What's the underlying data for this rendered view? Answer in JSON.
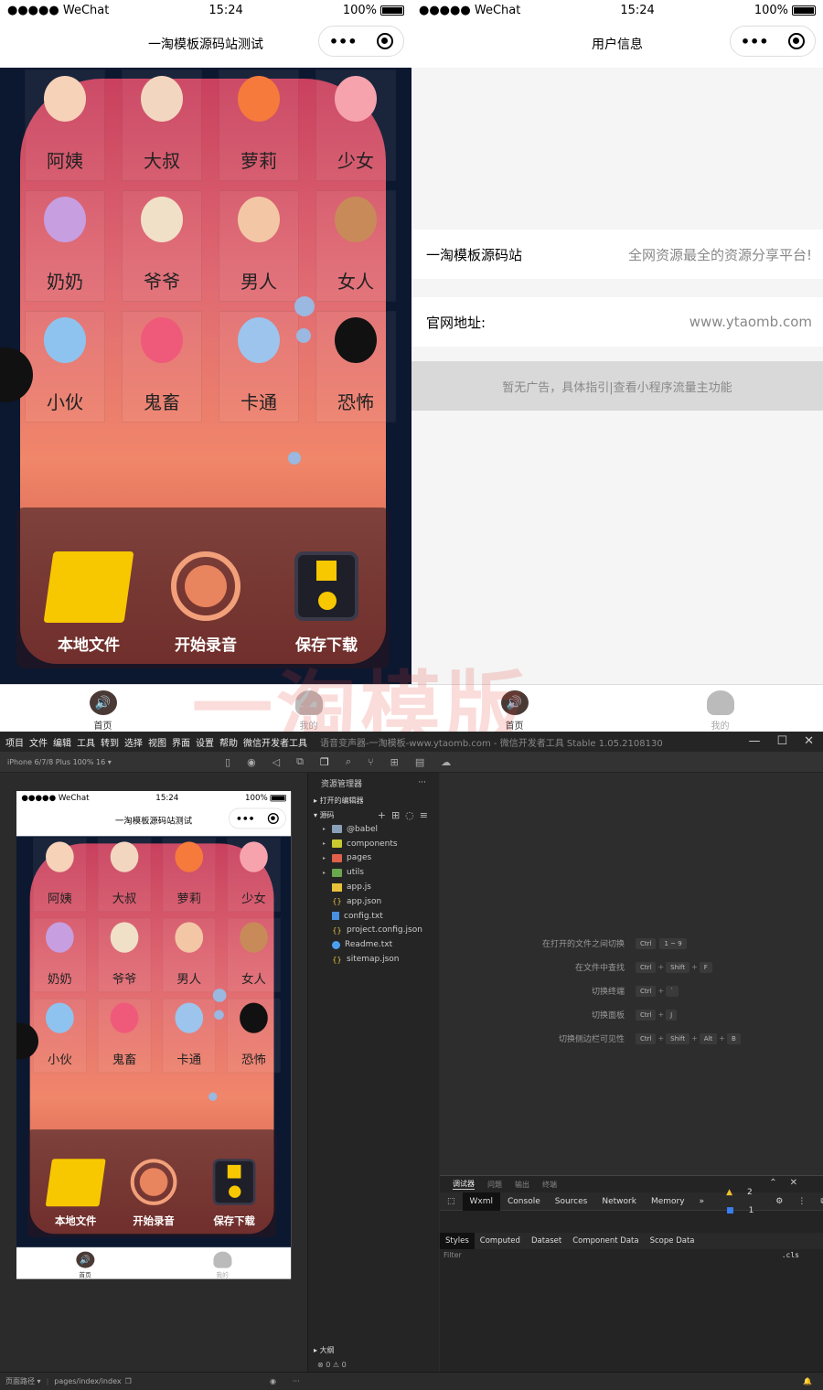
{
  "phone_left": {
    "carrier": "●●●●● WeChat",
    "time": "15:24",
    "battery": "100%",
    "title": "一淘模板源码站测试",
    "grid": [
      {
        "label": "阿姨",
        "color": "#f6d2b8"
      },
      {
        "label": "大叔",
        "color": "#f3d6c0"
      },
      {
        "label": "萝莉",
        "color": "#f57a3c"
      },
      {
        "label": "少女",
        "color": "#f7a3ad"
      },
      {
        "label": "奶奶",
        "color": "#c79ee0"
      },
      {
        "label": "爷爷",
        "color": "#f1e0c8"
      },
      {
        "label": "男人",
        "color": "#f3c7a6"
      },
      {
        "label": "女人",
        "color": "#c98a5a"
      },
      {
        "label": "小伙",
        "color": "#8ec3ef"
      },
      {
        "label": "鬼畜",
        "color": "#f05a7a"
      },
      {
        "label": "卡通",
        "color": "#9cc4ec"
      },
      {
        "label": "恐怖",
        "color": "#111111"
      }
    ],
    "buttons": [
      "本地文件",
      "开始录音",
      "保存下载"
    ],
    "tabs": [
      {
        "label": "首页",
        "icon": "speaker-icon"
      },
      {
        "label": "我的",
        "icon": "user-icon"
      }
    ]
  },
  "phone_right": {
    "carrier": "●●●●● WeChat",
    "time": "15:24",
    "battery": "100%",
    "title": "用户信息",
    "rows": [
      {
        "label": "一淘模板源码站",
        "value": "全网资源最全的资源分享平台!"
      },
      {
        "label": "官网地址:",
        "value": "www.ytaomb.com"
      }
    ],
    "ad": "暂无广告，具体指引|查看小程序流量主功能",
    "tabs": [
      {
        "label": "首页",
        "icon": "speaker-icon"
      },
      {
        "label": "我的",
        "icon": "user-icon"
      }
    ]
  },
  "watermark": "一淘模版",
  "devtools": {
    "menu": [
      "项目",
      "文件",
      "编辑",
      "工具",
      "转到",
      "选择",
      "视图",
      "界面",
      "设置",
      "帮助",
      "微信开发者工具"
    ],
    "window_title": "语音变声器-一淘模板-www.ytaomb.com - 微信开发者工具 Stable 1.05.2108130",
    "device": "iPhone 6/7/8 Plus 100% 16 ▾",
    "explorer": {
      "title": "资源管理器",
      "open_editors": "打开的编辑器",
      "source": "源码",
      "files": [
        {
          "name": "@babel",
          "type": "folder",
          "color": "#8aa0b8"
        },
        {
          "name": "components",
          "type": "folder",
          "color": "#c8c830"
        },
        {
          "name": "pages",
          "type": "folder",
          "color": "#e0604a"
        },
        {
          "name": "utils",
          "type": "folder",
          "color": "#6aa84f"
        },
        {
          "name": "app.js",
          "type": "js",
          "color": "#e8c13a"
        },
        {
          "name": "app.json",
          "type": "json",
          "color": "#e8c13a"
        },
        {
          "name": "config.txt",
          "type": "txt",
          "color": "#4a8fe0"
        },
        {
          "name": "project.config.json",
          "type": "json",
          "color": "#e8c13a"
        },
        {
          "name": "Readme.txt",
          "type": "info",
          "color": "#4a9ff0"
        },
        {
          "name": "sitemap.json",
          "type": "json",
          "color": "#e8c13a"
        }
      ],
      "outline": "大纲",
      "problems": "⊗ 0 ⚠ 0"
    },
    "shortcuts": [
      {
        "name": "在打开的文件之间切换",
        "keys": [
          "Ctrl",
          "1 ~ 9"
        ],
        "sep": ""
      },
      {
        "name": "在文件中查找",
        "keys": [
          "Ctrl",
          "Shift",
          "F"
        ],
        "sep": "+"
      },
      {
        "name": "切换终端",
        "keys": [
          "Ctrl",
          "`"
        ],
        "sep": "+"
      },
      {
        "name": "切换面板",
        "keys": [
          "Ctrl",
          "J"
        ],
        "sep": "+"
      },
      {
        "name": "切换侧边栏可见性",
        "keys": [
          "Ctrl",
          "Shift",
          "Alt",
          "B"
        ],
        "sep": "+"
      }
    ],
    "debug_tabs": [
      "调试器",
      "问题",
      "输出",
      "终端"
    ],
    "console_tabs": [
      "Wxml",
      "Console",
      "Sources",
      "Network",
      "Memory",
      "»"
    ],
    "warnings": "2",
    "infos": "1",
    "style_tabs": [
      "Styles",
      "Computed",
      "Dataset",
      "Component Data",
      "Scope Data"
    ],
    "filter_placeholder": "Filter",
    "cls": ".cls",
    "page_path_label": "页面路径 ▾",
    "page_path": "pages/index/index"
  }
}
